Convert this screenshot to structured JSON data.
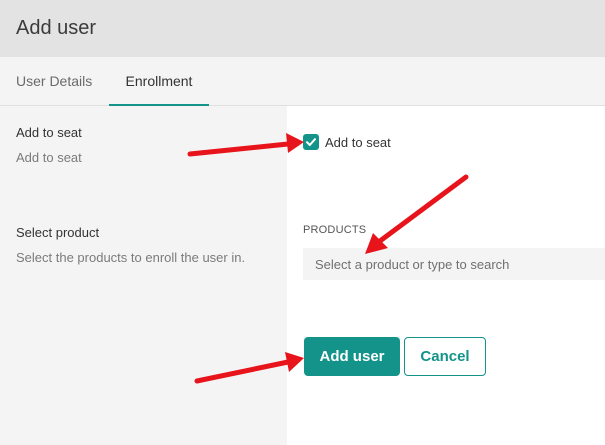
{
  "header": {
    "title": "Add user"
  },
  "tabs": [
    {
      "label": "User Details",
      "active": false
    },
    {
      "label": "Enrollment",
      "active": true
    }
  ],
  "seat_section": {
    "title": "Add to seat",
    "description": "Add to seat",
    "checkbox_label": "Add to seat",
    "checked": true
  },
  "product_section": {
    "title": "Select product",
    "description": "Select the products to enroll the user in.",
    "field_label": "PRODUCTS",
    "placeholder": "Select a product or type to search",
    "value": ""
  },
  "actions": {
    "add_label": "Add user",
    "cancel_label": "Cancel"
  },
  "colors": {
    "accent": "#13938a",
    "header_bg": "#e3e3e3",
    "panel_bg": "#f4f4f4",
    "annotation_arrow": "#e8141b"
  },
  "icons": {
    "checkbox": "check-icon",
    "annotation": "arrow-icon"
  }
}
